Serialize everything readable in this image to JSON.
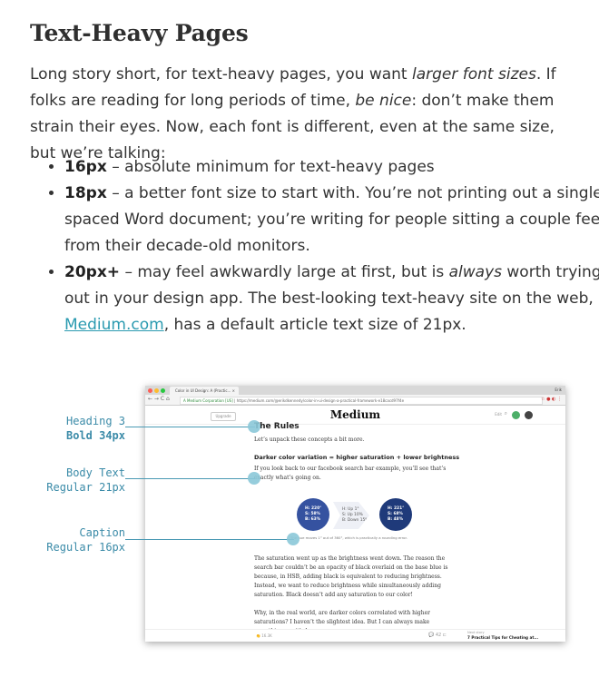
{
  "heading": "Text-Heavy Pages",
  "intro": {
    "p1": "Long story short, for text-heavy pages, you want ",
    "em1": "larger font sizes",
    "p2": ". If folks are reading for long periods of time, ",
    "em2": "be nice",
    "p3": ": don’t make them strain their eyes. Now, each font is different, even at the same size, but we’re talking:"
  },
  "bullets": [
    {
      "strong": "16px",
      "text": " – absolute minimum for text-heavy pages"
    },
    {
      "strong": "18px",
      "text": " – a better font size to start with. You’re not printing out a single-spaced Word document; you’re writing for people sitting a couple feet from their decade-old monitors."
    },
    {
      "strong": "20px+",
      "text_a": " – may feel awkwardly large at first, but is ",
      "em": "always",
      "text_b": " worth trying out in your design app. The best-looking text-heavy site on the web, ",
      "link": "Medium.com",
      "text_c": ", has a default article text size of 21px."
    }
  ],
  "figure": {
    "labels": [
      {
        "line1": "Heading 3",
        "line2": "Bold 34px"
      },
      {
        "line1": "Body Text",
        "line2": "Regular 21px"
      },
      {
        "line1": "Caption",
        "line2": "Regular 16px"
      }
    ],
    "browser": {
      "tab_title": "Color in UI Design: A (Practic... ×",
      "url_secure": "A Medium Corporation [US]",
      "url": "https://medium.com/@erikdkennedy/color-in-ui-design-a-practical-framework-e18cacd97f4e",
      "user_label": "Erik",
      "upgrade": "Upgrade",
      "brand": "Medium",
      "nav": "Edit",
      "article": {
        "heading": "The Rules",
        "intro": "Let’s unpack these concepts a bit more.",
        "subhead": "Darker color variation = higher saturation + lower brightness",
        "body1": "If you look back to our facebook search bar example, you’ll see that’s exactly what’s going on.",
        "circle1": [
          "H: 220°",
          "S: 58%",
          "B: 63%"
        ],
        "arrow": [
          "H: Up 1°",
          "S: Up 10%",
          "B: Down 15%"
        ],
        "circle2": [
          "H: 221°",
          "S: 68%",
          "B: 48%"
        ],
        "caption": "The hue moves 1° out of 360°, which is practically a rounding error.",
        "body2": "The saturation went up as the brightness went down. The reason the search bar couldn’t be an opacity of black overlaid on the base blue is because, in HSB, adding black is equivalent to reducing brightness. Instead, we want to reduce brightness while simultaneously adding saturation. Black doesn’t add any saturation to our color!",
        "body3": "Why, in the real world, are darker colors correlated with higher saturations? I haven’t the slightest idea. But I can always make something up: it’s because as"
      },
      "footer": {
        "claps": "16.3K",
        "responses": "42",
        "next_label": "Next story",
        "next_title": "7 Practical Tips for Cheating at..."
      }
    },
    "colors": {
      "accent": "#3b8ba8",
      "circle1": "#3552a0",
      "circle2": "#1f3a7a"
    }
  }
}
